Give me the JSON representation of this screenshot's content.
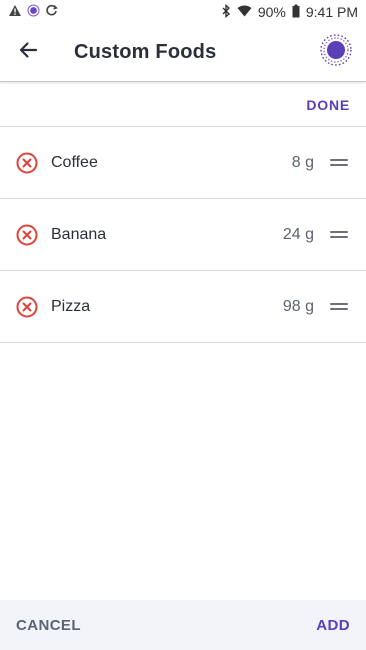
{
  "status_bar": {
    "battery": "90%",
    "time": "9:41 PM",
    "icons": [
      "warning-icon",
      "app-notification-icon",
      "sync-notification-icon",
      "bluetooth-icon",
      "wifi-icon",
      "battery-icon"
    ]
  },
  "header": {
    "title": "Custom Foods",
    "back_icon": "back-arrow-icon",
    "sync_icon": "device-sync-icon"
  },
  "toolbar": {
    "done_label": "DONE"
  },
  "foods": [
    {
      "name": "Coffee",
      "amount": "8 g"
    },
    {
      "name": "Banana",
      "amount": "24 g"
    },
    {
      "name": "Pizza",
      "amount": "98 g"
    }
  ],
  "footer": {
    "cancel_label": "CANCEL",
    "add_label": "ADD"
  },
  "colors": {
    "accent": "#5a3fb8",
    "remove": "#e0413a",
    "footer_bg": "#f3f4f9"
  }
}
